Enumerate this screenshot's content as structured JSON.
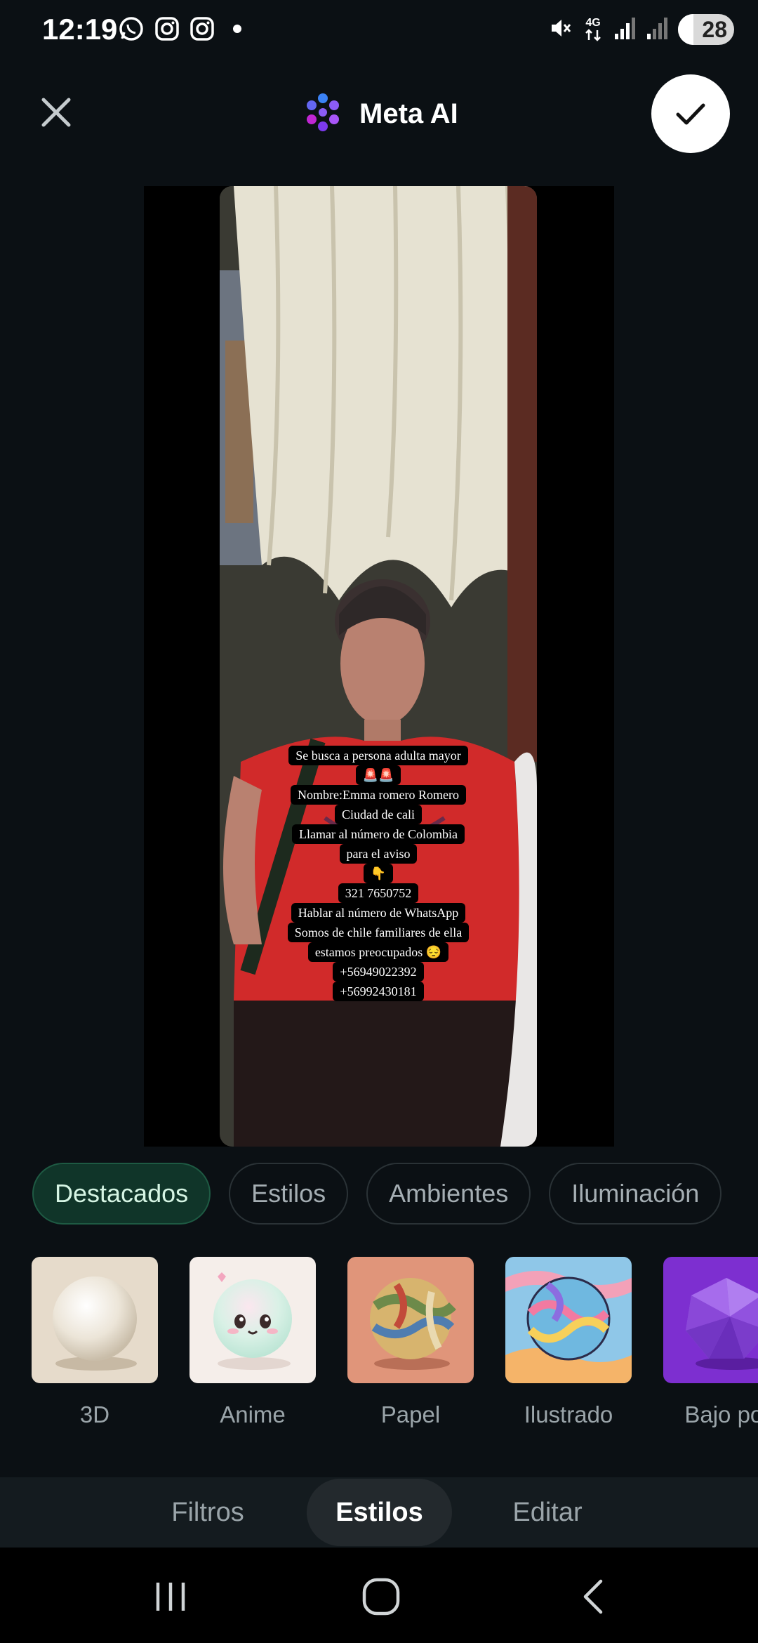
{
  "status_bar": {
    "time": "12:19",
    "battery": "28",
    "battery_fraction": 0.28,
    "network": "4G",
    "app_icons": [
      "whatsapp-icon",
      "instagram-icon",
      "instagram-icon",
      "notification-dot-icon"
    ],
    "system_icons": [
      "mute-icon",
      "network-4g-icon",
      "signal-icon",
      "signal-icon",
      "battery-icon"
    ]
  },
  "header": {
    "title": "Meta AI",
    "logo_icon": "meta-ai-logo-icon",
    "close_icon": "close-icon",
    "confirm_icon": "check-icon",
    "logo_color": "#8b5cf6"
  },
  "overlay": {
    "lines": [
      "Se busca a persona adulta mayor",
      "🚨🚨",
      "Nombre:Emma romero Romero",
      "Ciudad de cali",
      "Llamar al número de Colombia",
      "para el aviso",
      "👇",
      "321 7650752",
      "Hablar al número de WhatsApp",
      "Somos de chile familiares de ella",
      "estamos preocupados 😔",
      "+56949022392",
      "+56992430181"
    ]
  },
  "category_tabs": [
    {
      "label": "Destacados",
      "active": true
    },
    {
      "label": "Estilos",
      "active": false
    },
    {
      "label": "Ambientes",
      "active": false
    },
    {
      "label": "Iluminación",
      "active": false
    }
  ],
  "styles": [
    {
      "label": "3D",
      "thumb": "3d-sphere-thumbnail"
    },
    {
      "label": "Anime",
      "thumb": "anime-sphere-thumbnail"
    },
    {
      "label": "Papel",
      "thumb": "paper-sphere-thumbnail"
    },
    {
      "label": "Ilustrado",
      "thumb": "illustrated-sphere-thumbnail"
    },
    {
      "label": "Bajo pol",
      "thumb": "low-poly-sphere-thumbnail"
    }
  ],
  "bottom_tabs": [
    {
      "label": "Filtros",
      "active": false
    },
    {
      "label": "Estilos",
      "active": true
    },
    {
      "label": "Editar",
      "active": false
    }
  ],
  "system_nav": {
    "recents_icon": "recents-icon",
    "home_icon": "home-icon",
    "back_icon": "back-icon"
  },
  "colors": {
    "background": "#0b1014",
    "active_tab_bg": "#103529",
    "active_tab_text": "#d6f5e4",
    "overlay_text_bg": "#000000"
  }
}
